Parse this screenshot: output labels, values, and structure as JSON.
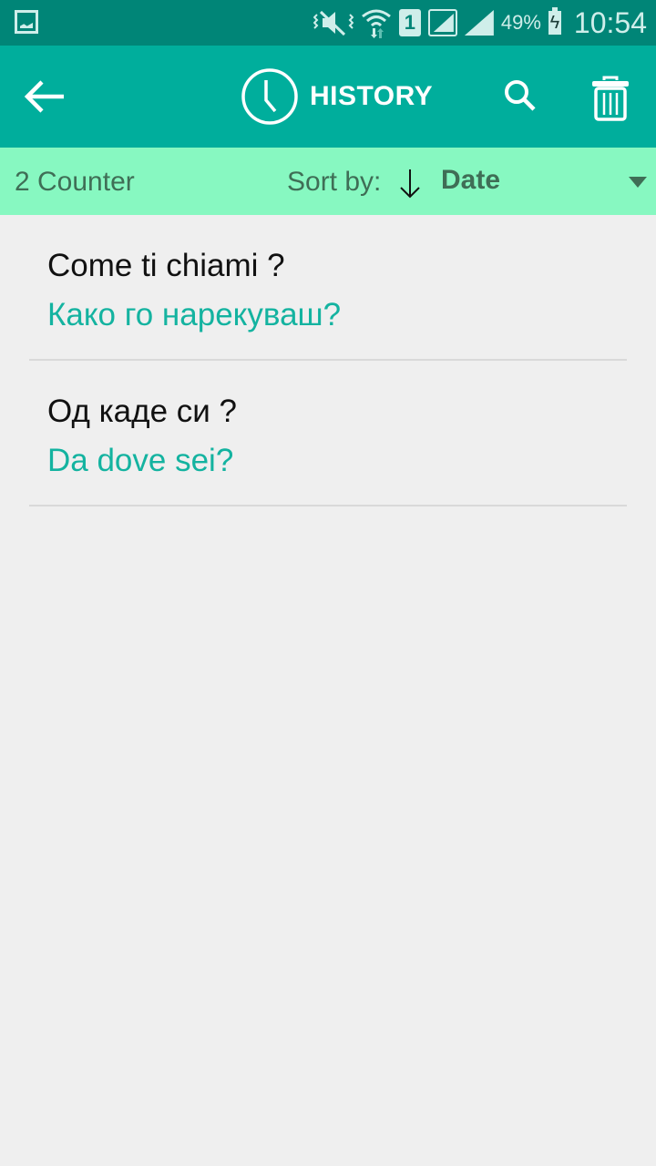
{
  "status_bar": {
    "left_icon": "gallery-icon",
    "icons": [
      "vibrate-mute-icon",
      "wifi-icon",
      "sim-1-icon",
      "signal-icon",
      "signal-icon"
    ],
    "sim_label": "1",
    "battery_percent": "49%",
    "time": "10:54"
  },
  "app_bar": {
    "back_icon": "arrow-left-icon",
    "title_icon": "clock-icon",
    "title": "HISTORY",
    "search_icon": "search-icon",
    "delete_icon": "trash-icon"
  },
  "sort_bar": {
    "counter": "2 Counter",
    "sort_label": "Sort by:",
    "sort_direction": "descending",
    "sort_value": "Date"
  },
  "history": [
    {
      "source": "Come ti chiami ?",
      "translation": "Како го нарекуваш?"
    },
    {
      "source": "Од каде си ?",
      "translation": "Da dove sei?"
    }
  ],
  "colors": {
    "status_bar": "#008577",
    "app_bar": "#00ae9c",
    "sort_bar": "#87f8c1",
    "translation_text": "#14b3a0",
    "background": "#efefef"
  }
}
